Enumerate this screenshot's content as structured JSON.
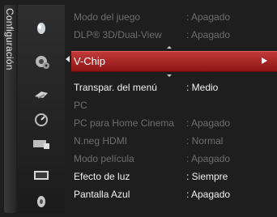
{
  "sidebar": {
    "title": "Configuración"
  },
  "icons": [
    "picture-icon",
    "setup-gear-icon",
    "channel-icon",
    "time-icon",
    "input-icon",
    "application-icon",
    "support-icon"
  ],
  "menu": {
    "items": [
      {
        "label": "Modo del juego",
        "value": ": Apagado",
        "state": "disabled"
      },
      {
        "label": "DLP® 3D/Dual-View",
        "value": ": Apagado",
        "state": "disabled"
      },
      {
        "label": "V-Chip",
        "value": "",
        "state": "selected"
      },
      {
        "label": "Transpar. del menú",
        "value": ": Medio",
        "state": "normal"
      },
      {
        "label": "PC",
        "value": "",
        "state": "disabled"
      },
      {
        "label": "PC para Home Cinema",
        "value": ": Apagado",
        "state": "disabled"
      },
      {
        "label": "N.neg HDMI",
        "value": ": Normal",
        "state": "disabled"
      },
      {
        "label": "Modo película",
        "value": ": Apagado",
        "state": "disabled"
      },
      {
        "label": "Efecto de luz",
        "value": ": Siempre",
        "state": "normal"
      },
      {
        "label": "Pantalla Azul",
        "value": ": Apagado",
        "state": "normal"
      }
    ]
  },
  "colors": {
    "selected_bar": "#b52a2a",
    "enabled_text": "#f2f2f2",
    "disabled_text": "#6e6e6e"
  }
}
